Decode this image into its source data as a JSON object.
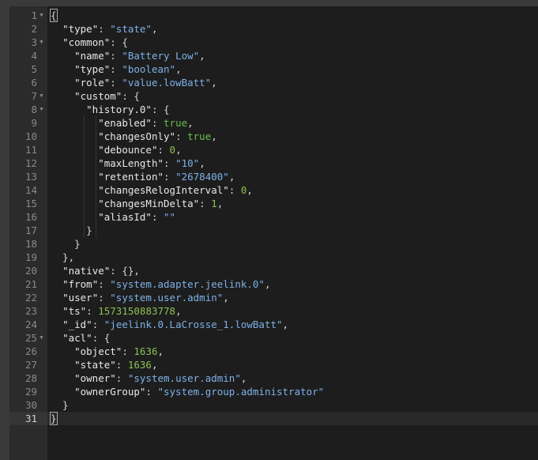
{
  "editor": {
    "active_line": 31,
    "lines": [
      {
        "n": "1",
        "fold": true,
        "tokens": [
          {
            "t": "p",
            "v": "{"
          }
        ]
      },
      {
        "n": "2",
        "fold": false,
        "tokens": [
          {
            "t": "p",
            "v": "  "
          },
          {
            "t": "k",
            "v": "\"type\""
          },
          {
            "t": "p",
            "v": ": "
          },
          {
            "t": "s",
            "v": "\"state\""
          },
          {
            "t": "p",
            "v": ","
          }
        ]
      },
      {
        "n": "3",
        "fold": true,
        "tokens": [
          {
            "t": "p",
            "v": "  "
          },
          {
            "t": "k",
            "v": "\"common\""
          },
          {
            "t": "p",
            "v": ": {"
          }
        ]
      },
      {
        "n": "4",
        "fold": false,
        "tokens": [
          {
            "t": "p",
            "v": "    "
          },
          {
            "t": "k",
            "v": "\"name\""
          },
          {
            "t": "p",
            "v": ": "
          },
          {
            "t": "s",
            "v": "\"Battery Low\""
          },
          {
            "t": "p",
            "v": ","
          }
        ]
      },
      {
        "n": "5",
        "fold": false,
        "tokens": [
          {
            "t": "p",
            "v": "    "
          },
          {
            "t": "k",
            "v": "\"type\""
          },
          {
            "t": "p",
            "v": ": "
          },
          {
            "t": "s",
            "v": "\"boolean\""
          },
          {
            "t": "p",
            "v": ","
          }
        ]
      },
      {
        "n": "6",
        "fold": false,
        "tokens": [
          {
            "t": "p",
            "v": "    "
          },
          {
            "t": "k",
            "v": "\"role\""
          },
          {
            "t": "p",
            "v": ": "
          },
          {
            "t": "s",
            "v": "\"value.lowBatt\""
          },
          {
            "t": "p",
            "v": ","
          }
        ]
      },
      {
        "n": "7",
        "fold": true,
        "tokens": [
          {
            "t": "p",
            "v": "    "
          },
          {
            "t": "k",
            "v": "\"custom\""
          },
          {
            "t": "p",
            "v": ": {"
          }
        ]
      },
      {
        "n": "8",
        "fold": true,
        "tokens": [
          {
            "t": "p",
            "v": "      "
          },
          {
            "t": "k",
            "v": "\"history.0\""
          },
          {
            "t": "p",
            "v": ": {"
          }
        ]
      },
      {
        "n": "9",
        "fold": false,
        "tokens": [
          {
            "t": "p",
            "v": "        "
          },
          {
            "t": "k",
            "v": "\"enabled\""
          },
          {
            "t": "p",
            "v": ": "
          },
          {
            "t": "b",
            "v": "true"
          },
          {
            "t": "p",
            "v": ","
          }
        ]
      },
      {
        "n": "10",
        "fold": false,
        "tokens": [
          {
            "t": "p",
            "v": "        "
          },
          {
            "t": "k",
            "v": "\"changesOnly\""
          },
          {
            "t": "p",
            "v": ": "
          },
          {
            "t": "b",
            "v": "true"
          },
          {
            "t": "p",
            "v": ","
          }
        ]
      },
      {
        "n": "11",
        "fold": false,
        "tokens": [
          {
            "t": "p",
            "v": "        "
          },
          {
            "t": "k",
            "v": "\"debounce\""
          },
          {
            "t": "p",
            "v": ": "
          },
          {
            "t": "n",
            "v": "0"
          },
          {
            "t": "p",
            "v": ","
          }
        ]
      },
      {
        "n": "12",
        "fold": false,
        "tokens": [
          {
            "t": "p",
            "v": "        "
          },
          {
            "t": "k",
            "v": "\"maxLength\""
          },
          {
            "t": "p",
            "v": ": "
          },
          {
            "t": "s",
            "v": "\"10\""
          },
          {
            "t": "p",
            "v": ","
          }
        ]
      },
      {
        "n": "13",
        "fold": false,
        "tokens": [
          {
            "t": "p",
            "v": "        "
          },
          {
            "t": "k",
            "v": "\"retention\""
          },
          {
            "t": "p",
            "v": ": "
          },
          {
            "t": "s",
            "v": "\"2678400\""
          },
          {
            "t": "p",
            "v": ","
          }
        ]
      },
      {
        "n": "14",
        "fold": false,
        "tokens": [
          {
            "t": "p",
            "v": "        "
          },
          {
            "t": "k",
            "v": "\"changesRelogInterval\""
          },
          {
            "t": "p",
            "v": ": "
          },
          {
            "t": "n",
            "v": "0"
          },
          {
            "t": "p",
            "v": ","
          }
        ]
      },
      {
        "n": "15",
        "fold": false,
        "tokens": [
          {
            "t": "p",
            "v": "        "
          },
          {
            "t": "k",
            "v": "\"changesMinDelta\""
          },
          {
            "t": "p",
            "v": ": "
          },
          {
            "t": "n",
            "v": "1"
          },
          {
            "t": "p",
            "v": ","
          }
        ]
      },
      {
        "n": "16",
        "fold": false,
        "tokens": [
          {
            "t": "p",
            "v": "        "
          },
          {
            "t": "k",
            "v": "\"aliasId\""
          },
          {
            "t": "p",
            "v": ": "
          },
          {
            "t": "s",
            "v": "\"\""
          }
        ]
      },
      {
        "n": "17",
        "fold": false,
        "tokens": [
          {
            "t": "p",
            "v": "      }"
          }
        ]
      },
      {
        "n": "18",
        "fold": false,
        "tokens": [
          {
            "t": "p",
            "v": "    }"
          }
        ]
      },
      {
        "n": "19",
        "fold": false,
        "tokens": [
          {
            "t": "p",
            "v": "  },"
          }
        ]
      },
      {
        "n": "20",
        "fold": false,
        "tokens": [
          {
            "t": "p",
            "v": "  "
          },
          {
            "t": "k",
            "v": "\"native\""
          },
          {
            "t": "p",
            "v": ": {},"
          }
        ]
      },
      {
        "n": "21",
        "fold": false,
        "tokens": [
          {
            "t": "p",
            "v": "  "
          },
          {
            "t": "k",
            "v": "\"from\""
          },
          {
            "t": "p",
            "v": ": "
          },
          {
            "t": "s",
            "v": "\"system.adapter.jeelink.0\""
          },
          {
            "t": "p",
            "v": ","
          }
        ]
      },
      {
        "n": "22",
        "fold": false,
        "tokens": [
          {
            "t": "p",
            "v": "  "
          },
          {
            "t": "k",
            "v": "\"user\""
          },
          {
            "t": "p",
            "v": ": "
          },
          {
            "t": "s",
            "v": "\"system.user.admin\""
          },
          {
            "t": "p",
            "v": ","
          }
        ]
      },
      {
        "n": "23",
        "fold": false,
        "tokens": [
          {
            "t": "p",
            "v": "  "
          },
          {
            "t": "k",
            "v": "\"ts\""
          },
          {
            "t": "p",
            "v": ": "
          },
          {
            "t": "n",
            "v": "1573150883778"
          },
          {
            "t": "p",
            "v": ","
          }
        ]
      },
      {
        "n": "24",
        "fold": false,
        "tokens": [
          {
            "t": "p",
            "v": "  "
          },
          {
            "t": "k",
            "v": "\"_id\""
          },
          {
            "t": "p",
            "v": ": "
          },
          {
            "t": "s",
            "v": "\"jeelink.0.LaCrosse_1.lowBatt\""
          },
          {
            "t": "p",
            "v": ","
          }
        ]
      },
      {
        "n": "25",
        "fold": true,
        "tokens": [
          {
            "t": "p",
            "v": "  "
          },
          {
            "t": "k",
            "v": "\"acl\""
          },
          {
            "t": "p",
            "v": ": {"
          }
        ]
      },
      {
        "n": "26",
        "fold": false,
        "tokens": [
          {
            "t": "p",
            "v": "    "
          },
          {
            "t": "k",
            "v": "\"object\""
          },
          {
            "t": "p",
            "v": ": "
          },
          {
            "t": "n",
            "v": "1636"
          },
          {
            "t": "p",
            "v": ","
          }
        ]
      },
      {
        "n": "27",
        "fold": false,
        "tokens": [
          {
            "t": "p",
            "v": "    "
          },
          {
            "t": "k",
            "v": "\"state\""
          },
          {
            "t": "p",
            "v": ": "
          },
          {
            "t": "n",
            "v": "1636"
          },
          {
            "t": "p",
            "v": ","
          }
        ]
      },
      {
        "n": "28",
        "fold": false,
        "tokens": [
          {
            "t": "p",
            "v": "    "
          },
          {
            "t": "k",
            "v": "\"owner\""
          },
          {
            "t": "p",
            "v": ": "
          },
          {
            "t": "s",
            "v": "\"system.user.admin\""
          },
          {
            "t": "p",
            "v": ","
          }
        ]
      },
      {
        "n": "29",
        "fold": false,
        "tokens": [
          {
            "t": "p",
            "v": "    "
          },
          {
            "t": "k",
            "v": "\"ownerGroup\""
          },
          {
            "t": "p",
            "v": ": "
          },
          {
            "t": "s",
            "v": "\"system.group.administrator\""
          }
        ]
      },
      {
        "n": "30",
        "fold": false,
        "tokens": [
          {
            "t": "p",
            "v": "  }"
          }
        ]
      },
      {
        "n": "31",
        "fold": false,
        "tokens": [
          {
            "t": "p",
            "v": "}"
          }
        ]
      }
    ]
  }
}
